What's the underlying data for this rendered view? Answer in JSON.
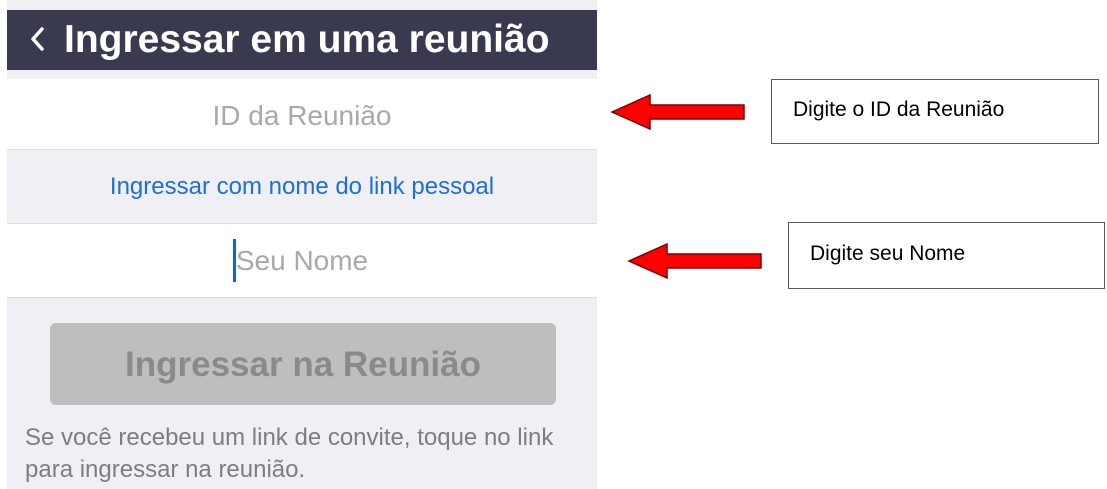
{
  "header": {
    "back_icon": "chevron-left-icon",
    "title": "Ingressar em uma reunião"
  },
  "meeting_id_field": {
    "placeholder": "ID da Reunião",
    "value": ""
  },
  "personal_link": {
    "label": "Ingressar com nome do link pessoal"
  },
  "name_field": {
    "placeholder": "Seu Nome",
    "value": ""
  },
  "join_button": {
    "label": "Ingressar na Reunião",
    "state": "disabled"
  },
  "hint": {
    "text": "Se você recebeu um link de convite, toque no link para ingressar na reunião."
  },
  "annotations": [
    {
      "text": "Digite o ID da Reunião",
      "arrow_icon": "red-arrow-left-icon"
    },
    {
      "text": "Digite seu Nome",
      "arrow_icon": "red-arrow-left-icon"
    }
  ],
  "colors": {
    "titlebar": "#393a4f",
    "link": "#1e6ed8",
    "button_disabled": "#bebebe",
    "arrow": "#ff0000"
  }
}
